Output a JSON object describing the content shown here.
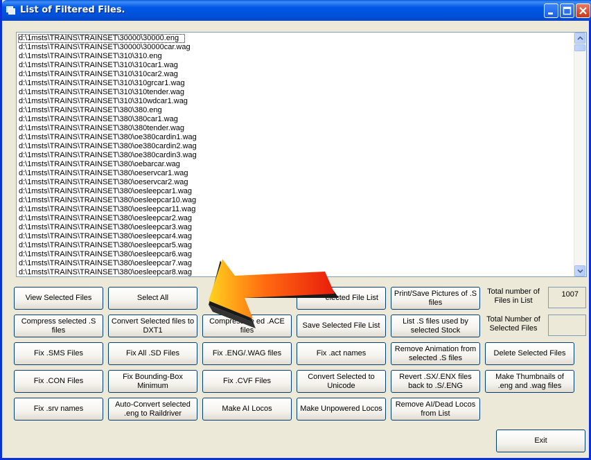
{
  "window": {
    "title": "List of Filtered Files."
  },
  "files": [
    "d:\\1msts\\TRAINS\\TRAINSET\\30000\\30000.eng",
    "d:\\1msts\\TRAINS\\TRAINSET\\30000\\30000car.wag",
    "d:\\1msts\\TRAINS\\TRAINSET\\310\\310.eng",
    "d:\\1msts\\TRAINS\\TRAINSET\\310\\310car1.wag",
    "d:\\1msts\\TRAINS\\TRAINSET\\310\\310car2.wag",
    "d:\\1msts\\TRAINS\\TRAINSET\\310\\310grcar1.wag",
    "d:\\1msts\\TRAINS\\TRAINSET\\310\\310tender.wag",
    "d:\\1msts\\TRAINS\\TRAINSET\\310\\310wdcar1.wag",
    "d:\\1msts\\TRAINS\\TRAINSET\\380\\380.eng",
    "d:\\1msts\\TRAINS\\TRAINSET\\380\\380car1.wag",
    "d:\\1msts\\TRAINS\\TRAINSET\\380\\380tender.wag",
    "d:\\1msts\\TRAINS\\TRAINSET\\380\\oe380cardin1.wag",
    "d:\\1msts\\TRAINS\\TRAINSET\\380\\oe380cardin2.wag",
    "d:\\1msts\\TRAINS\\TRAINSET\\380\\oe380cardin3.wag",
    "d:\\1msts\\TRAINS\\TRAINSET\\380\\oebarcar.wag",
    "d:\\1msts\\TRAINS\\TRAINSET\\380\\oeservcar1.wag",
    "d:\\1msts\\TRAINS\\TRAINSET\\380\\oeservcar2.wag",
    "d:\\1msts\\TRAINS\\TRAINSET\\380\\oesleepcar1.wag",
    "d:\\1msts\\TRAINS\\TRAINSET\\380\\oesleepcar10.wag",
    "d:\\1msts\\TRAINS\\TRAINSET\\380\\oesleepcar11.wag",
    "d:\\1msts\\TRAINS\\TRAINSET\\380\\oesleepcar2.wag",
    "d:\\1msts\\TRAINS\\TRAINSET\\380\\oesleepcar3.wag",
    "d:\\1msts\\TRAINS\\TRAINSET\\380\\oesleepcar4.wag",
    "d:\\1msts\\TRAINS\\TRAINSET\\380\\oesleepcar5.wag",
    "d:\\1msts\\TRAINS\\TRAINSET\\380\\oesleepcar6.wag",
    "d:\\1msts\\TRAINS\\TRAINSET\\380\\oesleepcar7.wag",
    "d:\\1msts\\TRAINS\\TRAINSET\\380\\oesleepcar8.wag"
  ],
  "buttons": {
    "view_selected": "View Selected Files",
    "select_all": "Select All",
    "load_selected_list": "elected File List",
    "print_save_pictures": "Print/Save Pictures of .S files",
    "compress_s": "Compress selected .S files",
    "convert_dxt1": "Convert Selected files to DXT1",
    "compress_ace": "Compress se  ed .ACE files",
    "save_selected_list": "Save Selected File List",
    "list_s_used": "List .S files used by selected Stock",
    "fix_sms": "Fix .SMS Files",
    "fix_all_sd": "Fix All .SD Files",
    "fix_eng_wag": "Fix .ENG/.WAG files",
    "fix_act": "Fix .act names",
    "remove_animation": "Remove Animation from selected .S files",
    "delete_selected": "Delete Selected Files",
    "fix_con": "Fix .CON Files",
    "fix_bounding_box": "Fix Bounding-Box Minimum",
    "fix_cvf": "Fix .CVF Files",
    "convert_unicode": "Convert Selected to Unicode",
    "revert_sx_enx": "Revert .SX/.ENX files back to .S/.ENG",
    "make_thumbnails": "Make Thumbnails of .eng and .wag files",
    "fix_srv": "Fix .srv names",
    "auto_convert_raildriver": "Auto-Convert selected .eng to Raildriver",
    "make_ai_locos": "Make AI Locos",
    "make_unpowered_locos": "Make Unpowered Locos",
    "remove_ai_dead_locos": "Remove AI/Dead Locos from List",
    "exit": "Exit"
  },
  "stats": {
    "total_label": "Total number of Files in List",
    "total_value": "1007",
    "selected_label": "Total Number of Selected Files",
    "selected_value": ""
  },
  "icons": {
    "app": "app-window-icon",
    "arrow": "pointer-arrow-icon"
  },
  "colors": {
    "titlebar": "#0058e6",
    "window_bg": "#ece9d8",
    "arrow_red": "#e81c0c",
    "arrow_yellow": "#ffd21e"
  }
}
